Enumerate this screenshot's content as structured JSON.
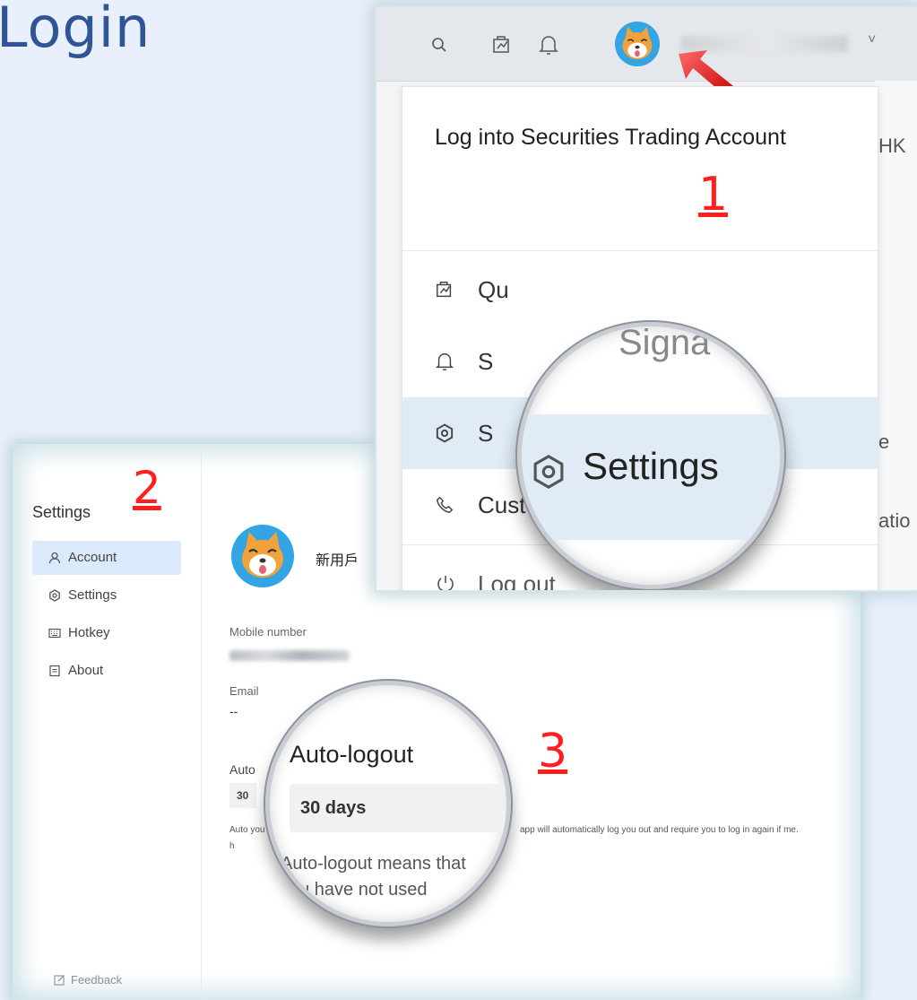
{
  "title": "Login",
  "menu_panel": {
    "step_number": "1",
    "login_text": "Log into Securities Trading Account",
    "items": [
      {
        "label": "Qu",
        "icon": "quote-icon"
      },
      {
        "label": "S",
        "icon": "bell-icon"
      },
      {
        "label": "S",
        "icon": "settings-icon"
      },
      {
        "label": "Custom",
        "icon": "phone-icon",
        "suffix": ">"
      },
      {
        "label": "Log out",
        "icon": "power-icon"
      }
    ],
    "magnifier": {
      "top_text": "Signa",
      "label": "Settings"
    },
    "right_fragments": {
      "hk": "HK",
      "e": "e",
      "atio": "atio"
    },
    "caret": "˅"
  },
  "settings_panel": {
    "step_number": "2",
    "heading": "Settings",
    "nav": [
      {
        "label": "Account",
        "icon": "user-icon"
      },
      {
        "label": "Settings",
        "icon": "settings-icon"
      },
      {
        "label": "Hotkey",
        "icon": "keyboard-icon"
      },
      {
        "label": "About",
        "icon": "document-icon"
      }
    ],
    "feedback": "Feedback",
    "user_name": "新用戶",
    "mobile_label": "Mobile number",
    "email_label": "Email",
    "email_value": "--",
    "auto_label_partial": "Auto",
    "auto_value_partial": "30",
    "desc_left": "Auto you h",
    "desc_right": "app will automatically log you out and require you to log in again if me."
  },
  "magnifier3": {
    "step_number": "3",
    "title": "Auto-logout",
    "value": "30 days",
    "desc": "Auto-logout means that you have not used"
  },
  "colors": {
    "accent": "#2f5597",
    "step": "#ff1f1f",
    "selected": "#dbeafb"
  }
}
